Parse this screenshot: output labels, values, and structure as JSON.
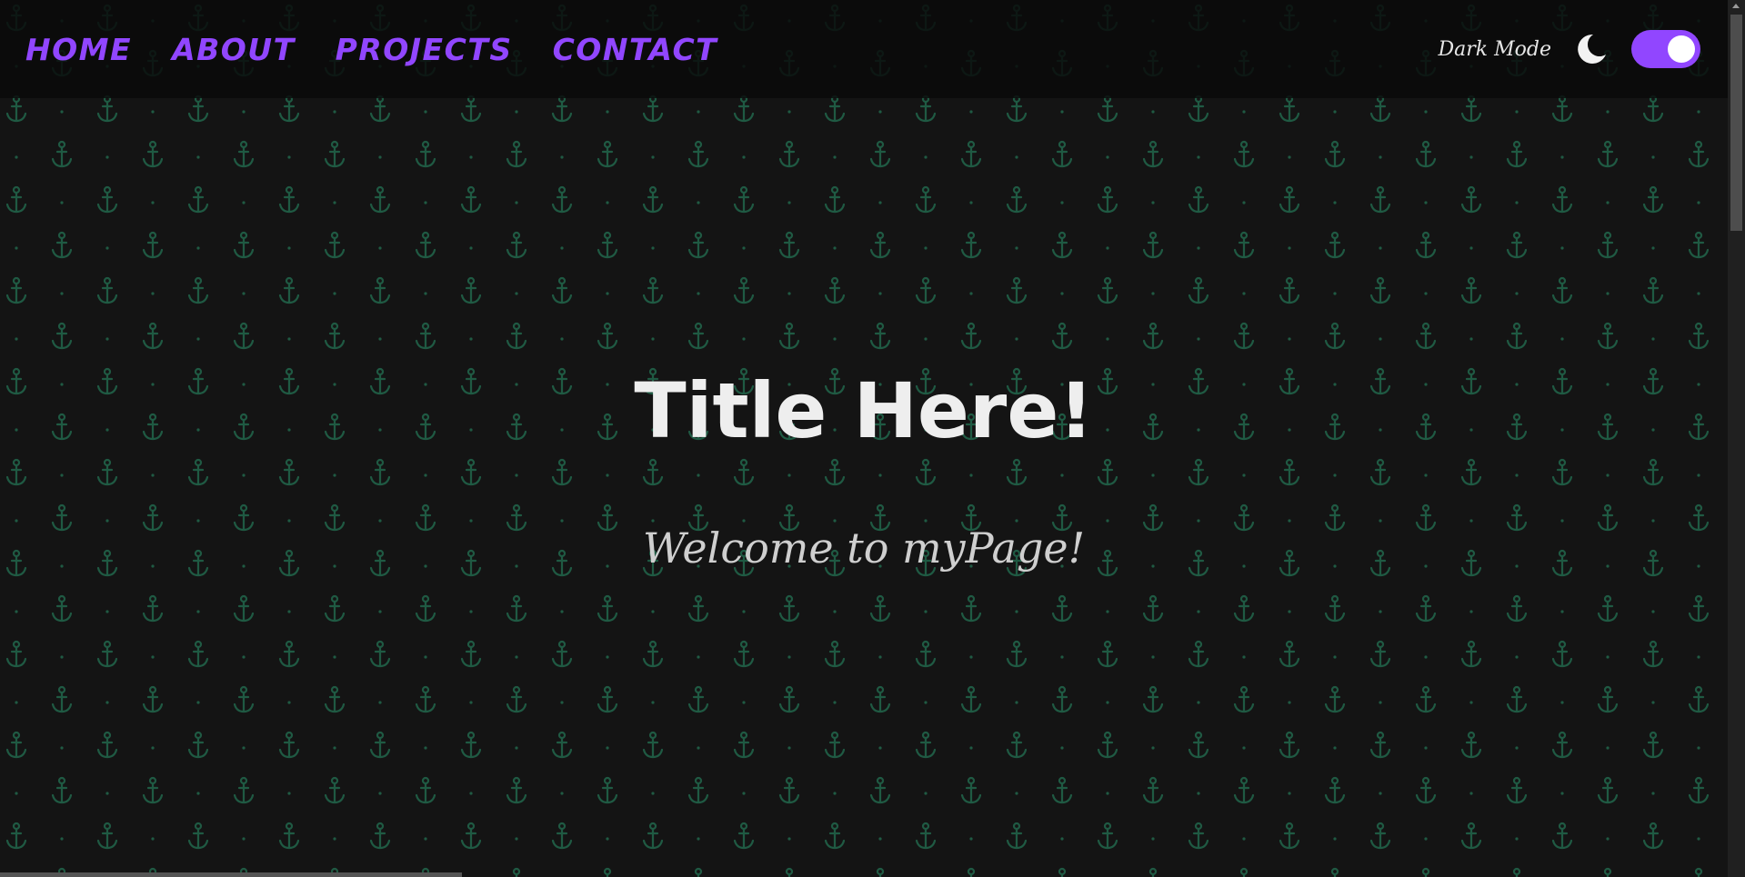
{
  "nav": {
    "links": [
      {
        "label": "HOME"
      },
      {
        "label": "ABOUT"
      },
      {
        "label": "PROJECTS"
      },
      {
        "label": "CONTACT"
      }
    ]
  },
  "mode": {
    "label": "Dark Mode",
    "icon": "moon-icon",
    "toggle_on": true
  },
  "hero": {
    "title": "Title Here!",
    "subtitle": "Welcome to myPage!"
  },
  "colors": {
    "accent": "#9146ff",
    "background": "#141414",
    "pattern": "#1f5a43",
    "text": "#eeeeee"
  }
}
